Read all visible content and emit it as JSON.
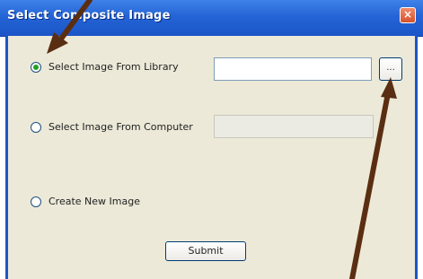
{
  "window": {
    "title": "Select Composite Image",
    "close_label": "×"
  },
  "options": [
    {
      "label": "Select Image From Library",
      "checked": true
    },
    {
      "label": "Select Image From Computer",
      "checked": false
    },
    {
      "label": "Create New Image",
      "checked": false
    }
  ],
  "library_input": {
    "value": ""
  },
  "computer_input": {
    "value": ""
  },
  "browse_button": {
    "label": "..."
  },
  "submit_button": {
    "label": "Submit"
  },
  "colors": {
    "titlebar": "#2464d6",
    "dialog_bg": "#ece9d8",
    "annotation_arrow": "#5a2e12"
  }
}
